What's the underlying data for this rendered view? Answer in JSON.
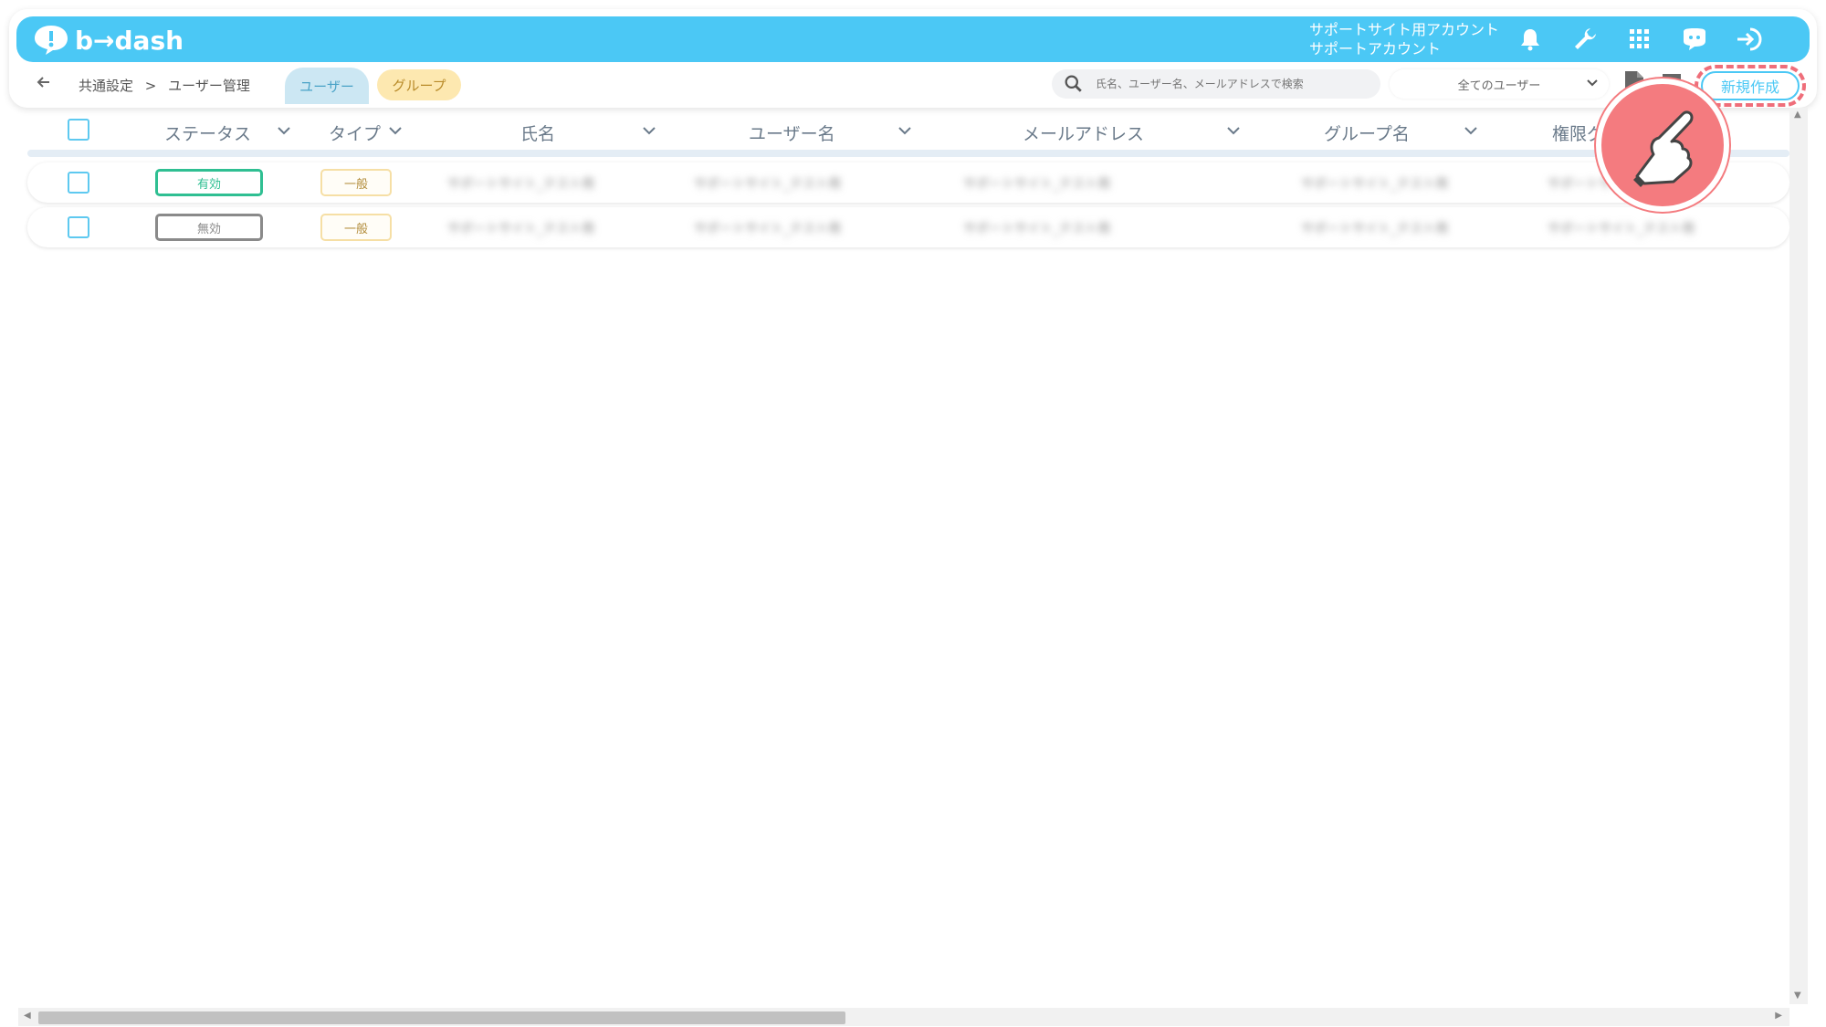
{
  "app": {
    "brand": "b→dash",
    "account_line1": "サポートサイト用アカウント",
    "account_line2": "サポートアカウント"
  },
  "breadcrumb": {
    "parent": "共通設定",
    "separator": ">",
    "current": "ユーザー管理"
  },
  "tabs": {
    "user": "ユーザー",
    "group": "グループ"
  },
  "search": {
    "placeholder": "氏名、ユーザー名、メールアドレスで検索"
  },
  "filter": {
    "selected": "全てのユーザー"
  },
  "toolbar": {
    "new_label": "新規作成"
  },
  "table": {
    "columns": [
      "ステータス",
      "タイプ",
      "氏名",
      "ユーザー名",
      "メールアドレス",
      "グループ名",
      "権限グ"
    ],
    "rows": [
      {
        "status": "有効",
        "type": "一般",
        "name": "サポートサイト_テスト用",
        "username": "サポートサイト_テスト用",
        "email": "サポートサイト_テスト用",
        "group": "サポートサイト_テスト用",
        "role": "サポートサイト_テスト用"
      },
      {
        "status": "無効",
        "type": "一般",
        "name": "サポートサイト_テスト用",
        "username": "サポートサイト_テスト用",
        "email": "サポートサイト_テスト用",
        "group": "サポートサイト_テスト用",
        "role": "サポートサイト_テスト用"
      }
    ]
  },
  "icons": {
    "bell": "bell-icon",
    "tools": "wrench-icon",
    "apps": "grid-icon",
    "assistant": "chat-bot-icon",
    "logout": "logout-icon"
  },
  "colors": {
    "brand": "#4bc8f5",
    "active": "#2fbf92",
    "inactive": "#8a8a8a",
    "highlight": "#ef6e7a"
  }
}
